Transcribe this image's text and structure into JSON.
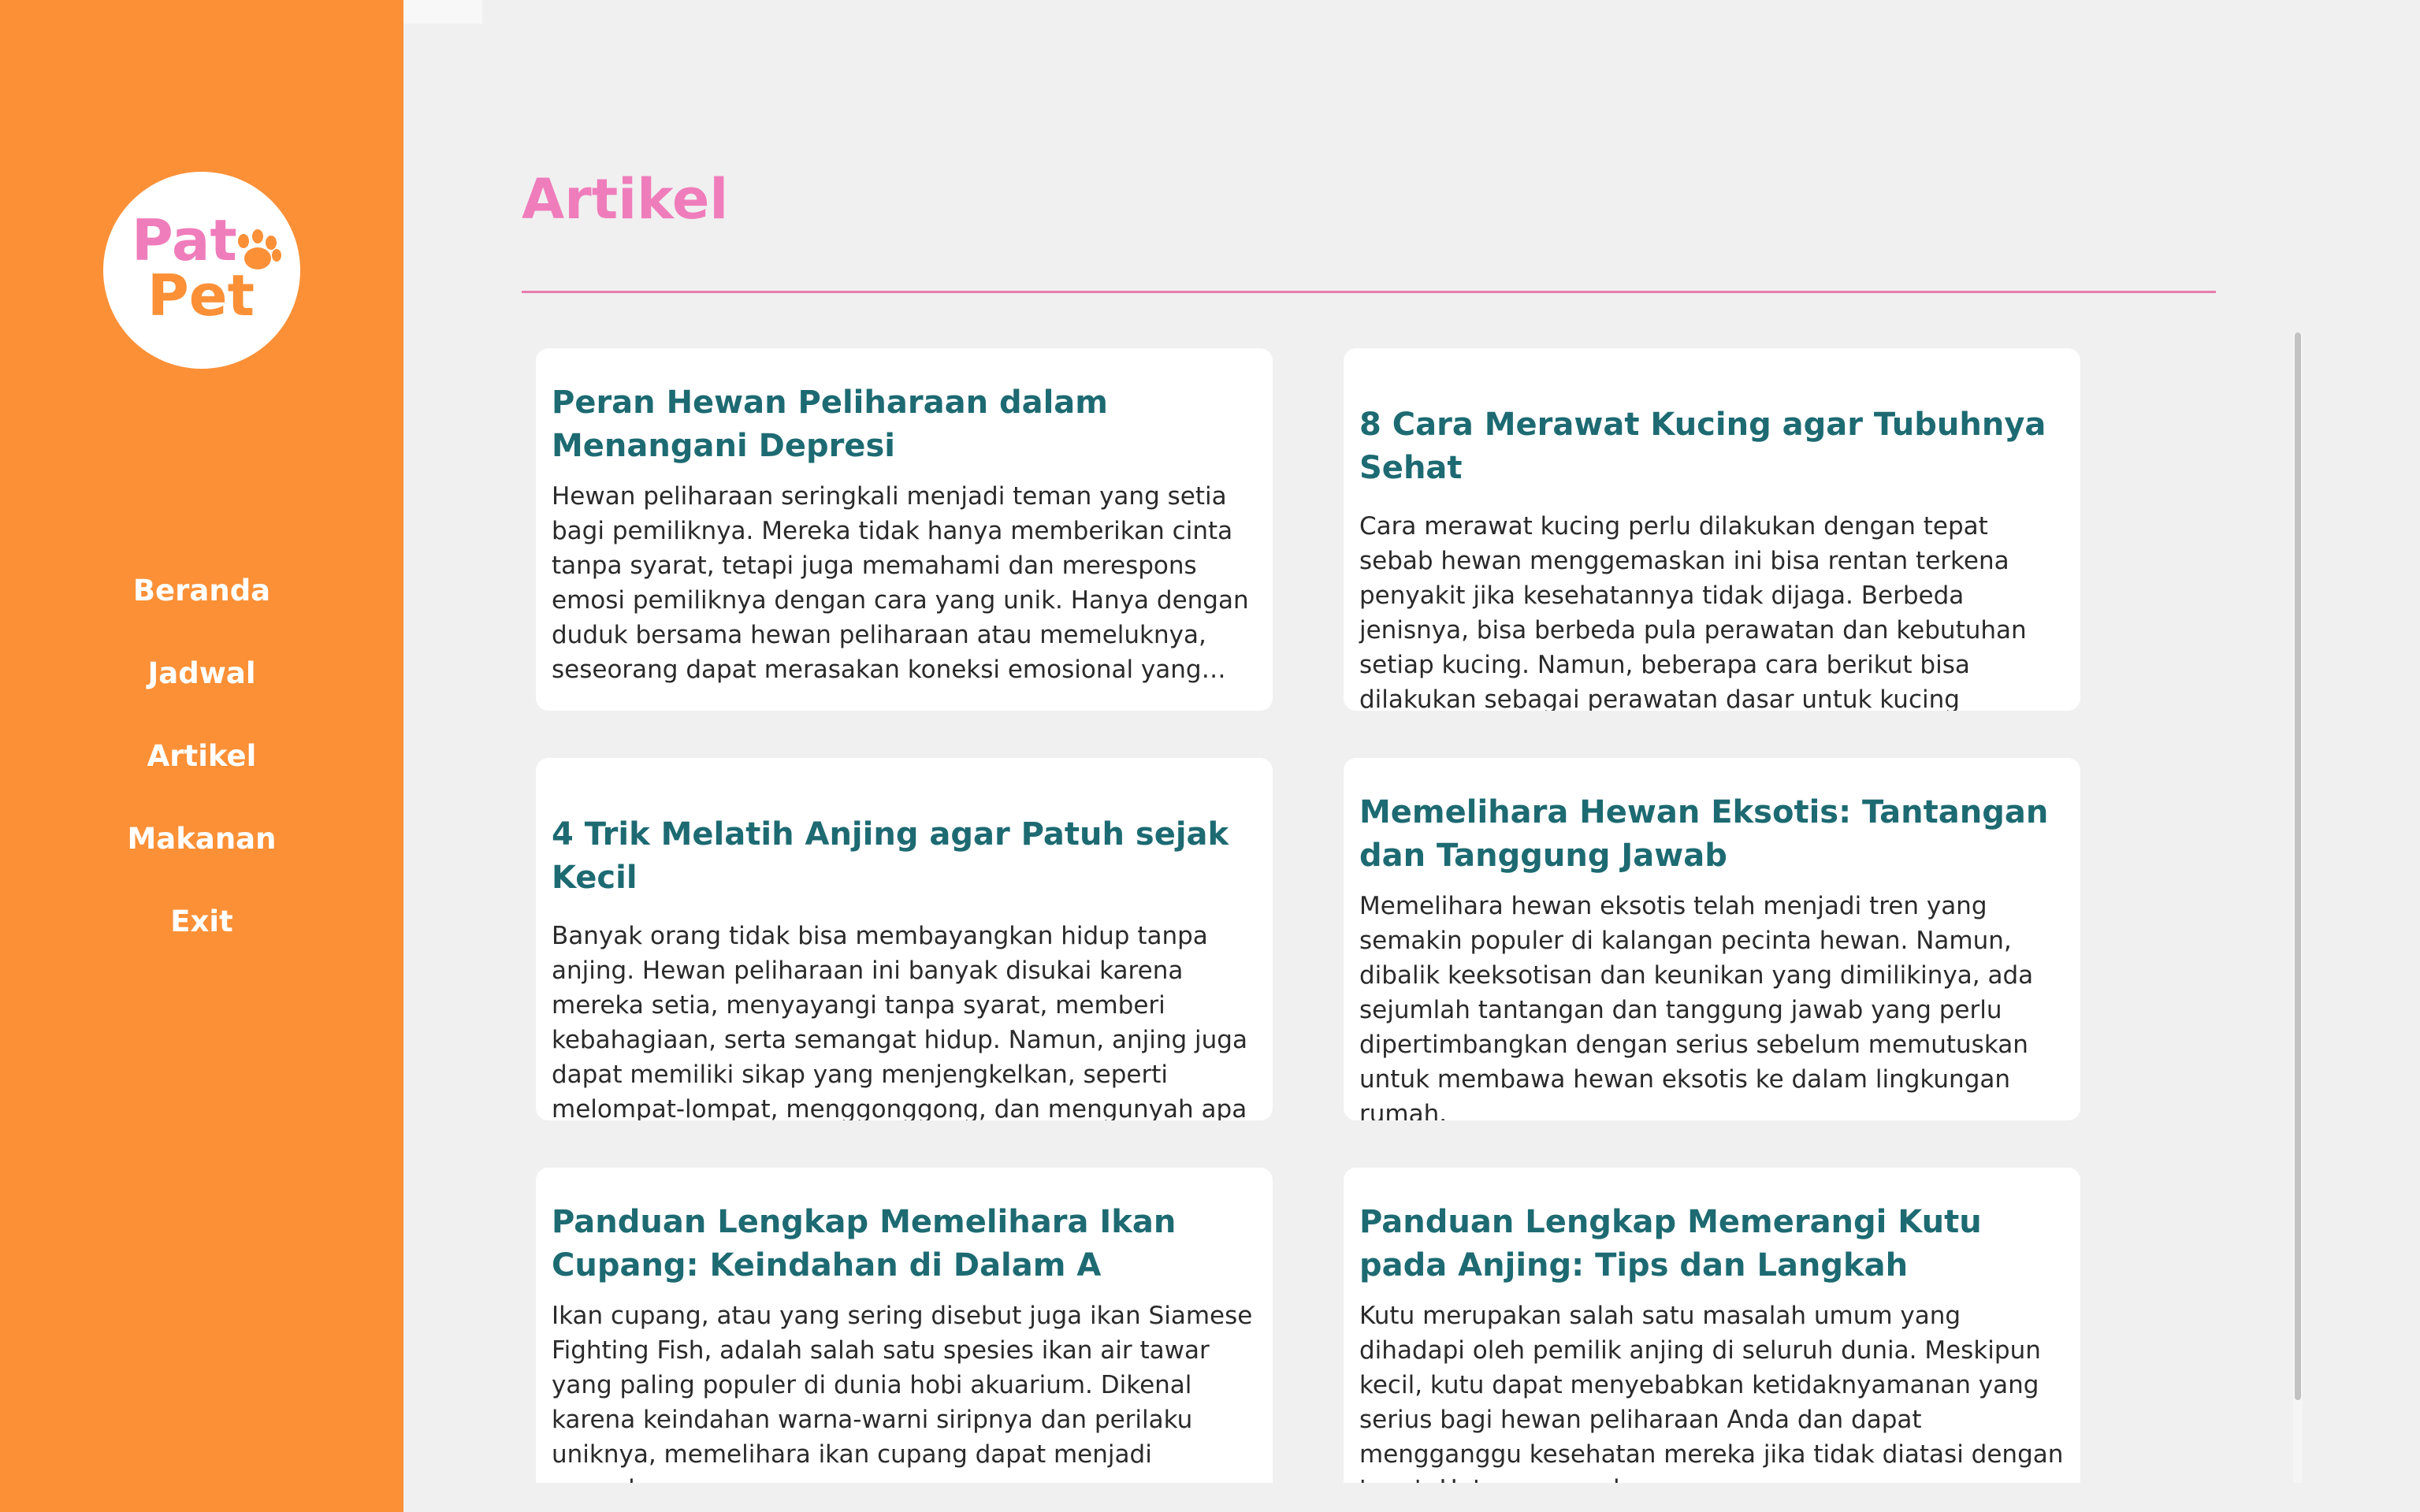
{
  "brand": {
    "logo_line1": "Pat",
    "logo_line2": "Pet",
    "sidebar_color": "#fb9037",
    "title_color": "#ef7dbb",
    "card_title_color": "#1d6a72"
  },
  "nav": {
    "items": [
      {
        "label": "Beranda"
      },
      {
        "label": "Jadwal"
      },
      {
        "label": "Artikel"
      },
      {
        "label": "Makanan"
      },
      {
        "label": "Exit"
      }
    ]
  },
  "page": {
    "title": "Artikel"
  },
  "articles": [
    {
      "title": "Peran Hewan Peliharaan dalam Menangani Depresi",
      "excerpt": "Hewan peliharaan seringkali menjadi teman yang setia bagi pemiliknya. Mereka tidak hanya memberikan cinta tanpa syarat, tetapi juga memahami dan merespons emosi pemiliknya dengan cara yang unik. Hanya dengan duduk bersama hewan peliharaan atau memeluknya, seseorang dapat merasakan koneksi emosional yang mendalam y..."
    },
    {
      "title": "8 Cara Merawat Kucing agar Tubuhnya Sehat",
      "excerpt": "Cara merawat kucing perlu dilakukan dengan tepat sebab hewan menggemaskan ini bisa rentan terkena penyakit jika kesehatannya tidak dijaga. Berbeda jenisnya, bisa berbeda pula perawatan dan kebutuhan setiap kucing. Namun, beberapa cara berikut bisa dilakukan sebagai perawatan dasar untuk kucing kesayanganmu."
    },
    {
      "title": "4 Trik Melatih Anjing agar Patuh sejak Kecil",
      "excerpt": "Banyak orang tidak bisa membayangkan hidup tanpa anjing. Hewan peliharaan ini banyak disukai karena mereka setia, menyayangi tanpa syarat, memberi kebahagiaan, serta semangat hidup. Namun, anjing juga dapat memiliki sikap yang menjengkelkan, seperti melompat-lompat, menggonggong, dan mengunyah apa pun."
    },
    {
      "title": "Memelihara Hewan Eksotis: Tantangan dan Tanggung Jawab",
      "excerpt": "Memelihara hewan eksotis telah menjadi tren yang semakin populer di kalangan pecinta hewan. Namun, dibalik keeksotisan dan keunikan yang dimilikinya, ada sejumlah tantangan dan tanggung jawab yang perlu dipertimbangkan dengan serius sebelum memutuskan untuk membawa hewan eksotis ke dalam lingkungan rumah."
    },
    {
      "title": "Panduan Lengkap Memelihara Ikan Cupang: Keindahan di Dalam A",
      "excerpt": "Ikan cupang, atau yang sering disebut juga ikan Siamese Fighting Fish, adalah salah satu spesies ikan air tawar yang paling populer di dunia hobi akuarium. Dikenal karena keindahan warna-warni siripnya dan perilaku uniknya, memelihara ikan cupang dapat menjadi pengalaman yang"
    },
    {
      "title": "Panduan Lengkap Memerangi Kutu pada Anjing: Tips dan Langkah",
      "excerpt": "Kutu merupakan salah satu masalah umum yang dihadapi oleh pemilik anjing di seluruh dunia. Meskipun kecil, kutu dapat menyebabkan ketidaknyamanan yang serius bagi hewan peliharaan Anda dan dapat mengganggu kesehatan mereka jika tidak diatasi dengan tepat. Untungnya, ada"
    }
  ]
}
